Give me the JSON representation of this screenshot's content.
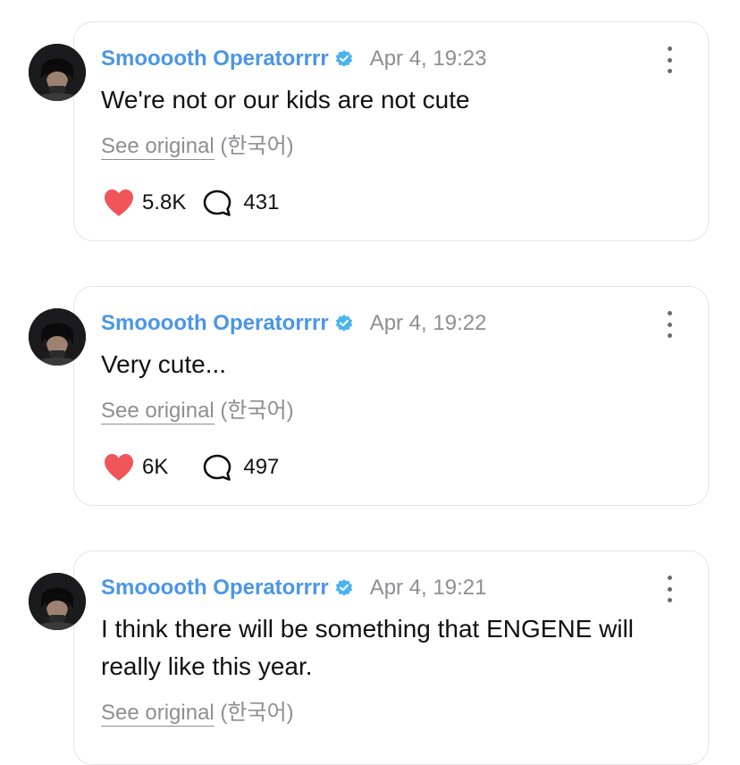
{
  "comments": [
    {
      "username": "Smooooth Operatorrrr",
      "timestamp": "Apr 4, 19:23",
      "text": "We're not or our kids are not cute",
      "see_original": "See original",
      "language": "(한국어)",
      "likes": "5.8K",
      "replies": "431"
    },
    {
      "username": "Smooooth Operatorrrr",
      "timestamp": "Apr 4, 19:22",
      "text": "Very cute...",
      "see_original": "See original",
      "language": "(한국어)",
      "likes": "6K",
      "replies": "497"
    },
    {
      "username": "Smooooth Operatorrrr",
      "timestamp": "Apr 4, 19:21",
      "text": "I think there will be something that ENGENE will really like this year.",
      "see_original": "See original",
      "language": "(한국어)",
      "likes": "",
      "replies": ""
    }
  ],
  "colors": {
    "username": "#4b96e6",
    "verified_badge": "#4bb3f0",
    "heart": "#f0555a",
    "muted_text": "#8e8e93",
    "card_border": "#e3e3e6"
  },
  "icons": {
    "verified": "verified-badge-icon",
    "more": "more-vertical-icon",
    "like": "heart-icon",
    "reply": "speech-bubble-icon"
  }
}
